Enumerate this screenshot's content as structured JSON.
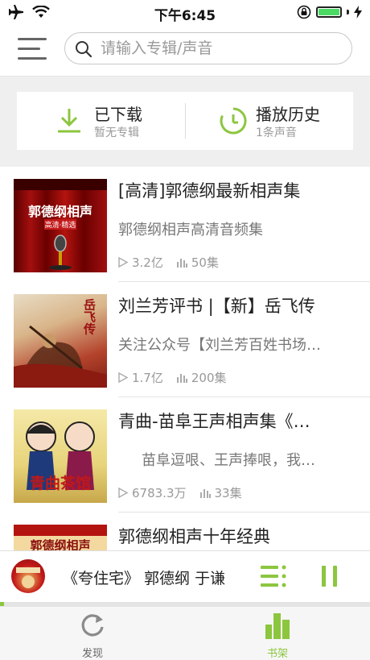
{
  "status_bar": {
    "time": "下午6:45"
  },
  "search": {
    "placeholder": "请输入专辑/声音"
  },
  "quick": {
    "downloaded_title": "已下载",
    "downloaded_sub": "暂无专辑",
    "history_title": "播放历史",
    "history_sub": "1条声音"
  },
  "albums": [
    {
      "title": "[高清]郭德纲最新相声集",
      "desc": "郭德纲相声高清音频集",
      "plays": "3.2亿",
      "episodes": "50集",
      "cover_text": "郭德纲相声",
      "cover_sub": "高清·精选"
    },
    {
      "title": "刘兰芳评书 |【新】岳飞传",
      "desc": "关注公众号【刘兰芳百姓书场…",
      "plays": "1.7亿",
      "episodes": "200集",
      "cover_text": "岳飞传"
    },
    {
      "title": "青曲-苗阜王声相声集《…",
      "desc": "苗阜逗哏、王声捧哏，我…",
      "plays": "6783.3万",
      "episodes": "33集",
      "cover_text": "青曲茶馆"
    },
    {
      "title": "郭德纲相声十年经典",
      "cover_text": "郭德纲相声"
    }
  ],
  "player": {
    "title": "《夸住宅》 郭德纲 于谦",
    "progress": 0.01
  },
  "tabs": {
    "discover": "发现",
    "bookshelf": "书架"
  },
  "colors": {
    "accent": "#8cc63f",
    "battery": "#4cd964"
  }
}
